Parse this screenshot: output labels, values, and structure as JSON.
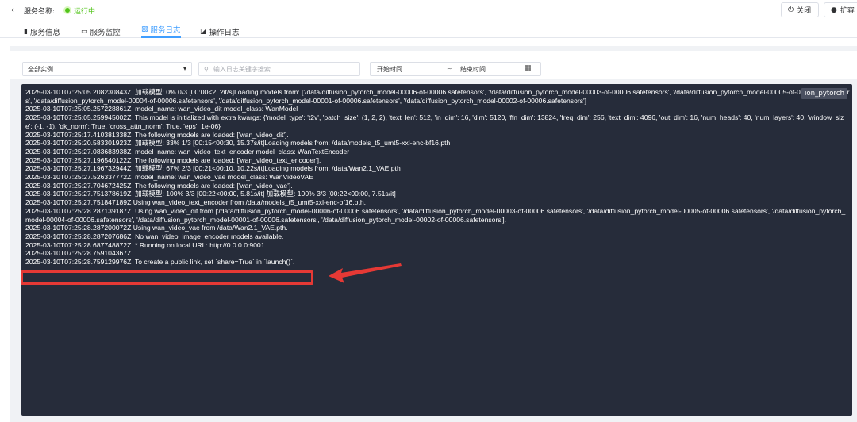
{
  "header": {
    "back_icon": "←",
    "service_name_label": "服务名称:",
    "status_text": "运行中",
    "status_color": "#52c41a",
    "close_icon": "⏻",
    "close_label": "关闭",
    "expand_icon": "●",
    "expand_label": "扩容"
  },
  "tabs": [
    {
      "icon": "▮",
      "label": "服务信息"
    },
    {
      "icon": "▭",
      "label": "服务监控"
    },
    {
      "icon": "▧",
      "label": "服务日志"
    },
    {
      "icon": "◪",
      "label": "操作日志"
    }
  ],
  "active_tab": 2,
  "accent_color": "#409eff",
  "filters": {
    "instance_select": {
      "value": "全部实例",
      "arrow": "▾"
    },
    "search": {
      "icon": "⚲",
      "placeholder": "输入日志关键字搜索"
    },
    "date_range": {
      "start_placeholder": "开始时间",
      "separator": "~",
      "end_placeholder": "结束时间",
      "calendar_icon": "▦"
    }
  },
  "console": {
    "background": "#262c3a",
    "collapse_tag": "ion_pytorch",
    "lines": [
      "2025-03-10T07:25:05.208230843Z  加载模型: 0% 0/3 [00:00<?, ?it/s]Loading models from: ['/data/diffusion_pytorch_model-00006-of-00006.safetensors', '/data/diffusion_pytorch_model-00003-of-00006.safetensors', '/data/diffusion_pytorch_model-00005-of-00006.safetensors', '/data/diffusion_pytorch_model-00004-of-00006.safetensors', '/data/diffusion_pytorch_model-00001-of-00006.safetensors', '/data/diffusion_pytorch_model-00002-of-00006.safetensors']",
      "2025-03-10T07:25:05.257228861Z  model_name: wan_video_dit model_class: WanModel",
      "2025-03-10T07:25:05.259945002Z  This model is initialized with extra kwargs: {'model_type': 't2v', 'patch_size': (1, 2, 2), 'text_len': 512, 'in_dim': 16, 'dim': 5120, 'ffn_dim': 13824, 'freq_dim': 256, 'text_dim': 4096, 'out_dim': 16, 'num_heads': 40, 'num_layers': 40, 'window_size': (-1, -1), 'qk_norm': True, 'cross_attn_norm': True, 'eps': 1e-06}",
      "2025-03-10T07:25:17.410381338Z  The following models are loaded: ['wan_video_dit'].",
      "2025-03-10T07:25:20.583301923Z  加载模型: 33% 1/3 [00:15<00:30, 15.37s/it]Loading models from: /data/models_t5_umt5-xxl-enc-bf16.pth",
      "2025-03-10T07:25:27.083683938Z  model_name: wan_video_text_encoder model_class: WanTextEncoder",
      "2025-03-10T07:25:27.196540122Z  The following models are loaded: ['wan_video_text_encoder'].",
      "2025-03-10T07:25:27.196732944Z  加载模型: 67% 2/3 [00:21<00:10, 10.22s/it]Loading models from: /data/Wan2.1_VAE.pth",
      "2025-03-10T07:25:27.526337772Z  model_name: wan_video_vae model_class: WanVideoVAE",
      "2025-03-10T07:25:27.704672425Z  The following models are loaded: ['wan_video_vae'].",
      "2025-03-10T07:25:27.751378619Z  加载模型: 100% 3/3 [00:22<00:00, 5.81s/it] 加载模型: 100% 3/3 [00:22<00:00, 7.51s/it]",
      "2025-03-10T07:25:27.751847189Z Using wan_video_text_encoder from /data/models_t5_umt5-xxl-enc-bf16.pth.",
      "2025-03-10T07:25:28.287139187Z  Using wan_video_dit from ['/data/diffusion_pytorch_model-00006-of-00006.safetensors', '/data/diffusion_pytorch_model-00003-of-00006.safetensors', '/data/diffusion_pytorch_model-00005-of-00006.safetensors', '/data/diffusion_pytorch_model-00004-of-00006.safetensors', '/data/diffusion_pytorch_model-00001-of-00006.safetensors', '/data/diffusion_pytorch_model-00002-of-00006.safetensors'].",
      "2025-03-10T07:25:28.287200072Z Using wan_video_vae from /data/Wan2.1_VAE.pth.",
      "2025-03-10T07:25:28.287207686Z  No wan_video_image_encoder models available.",
      "2025-03-10T07:25:28.687748872Z  * Running on local URL: http://0.0.0.0:9001",
      "2025-03-10T07:25:28.759104367Z",
      "2025-03-10T07:25:28.759129976Z  To create a public link, set `share=True` in `launch()`."
    ]
  },
  "annotation_color": "#e53935"
}
